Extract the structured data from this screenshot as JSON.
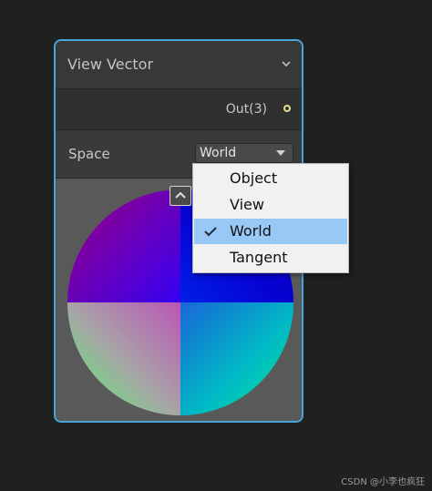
{
  "node": {
    "title": "View Vector",
    "collapse_icon": "chevron-down-icon",
    "output_port": "Out(3)",
    "space_label": "Space",
    "space_value": "World",
    "expand_icon": "chevron-up-icon"
  },
  "dropdown": {
    "items": [
      {
        "label": "Object",
        "selected": false
      },
      {
        "label": "View",
        "selected": false
      },
      {
        "label": "World",
        "selected": true
      },
      {
        "label": "Tangent",
        "selected": false
      }
    ]
  },
  "colors": {
    "node_border": "#44a6dd",
    "port_color": "#e7e183",
    "selected_item": "#98c8f5"
  },
  "watermark": "CSDN @小李也疯狂"
}
